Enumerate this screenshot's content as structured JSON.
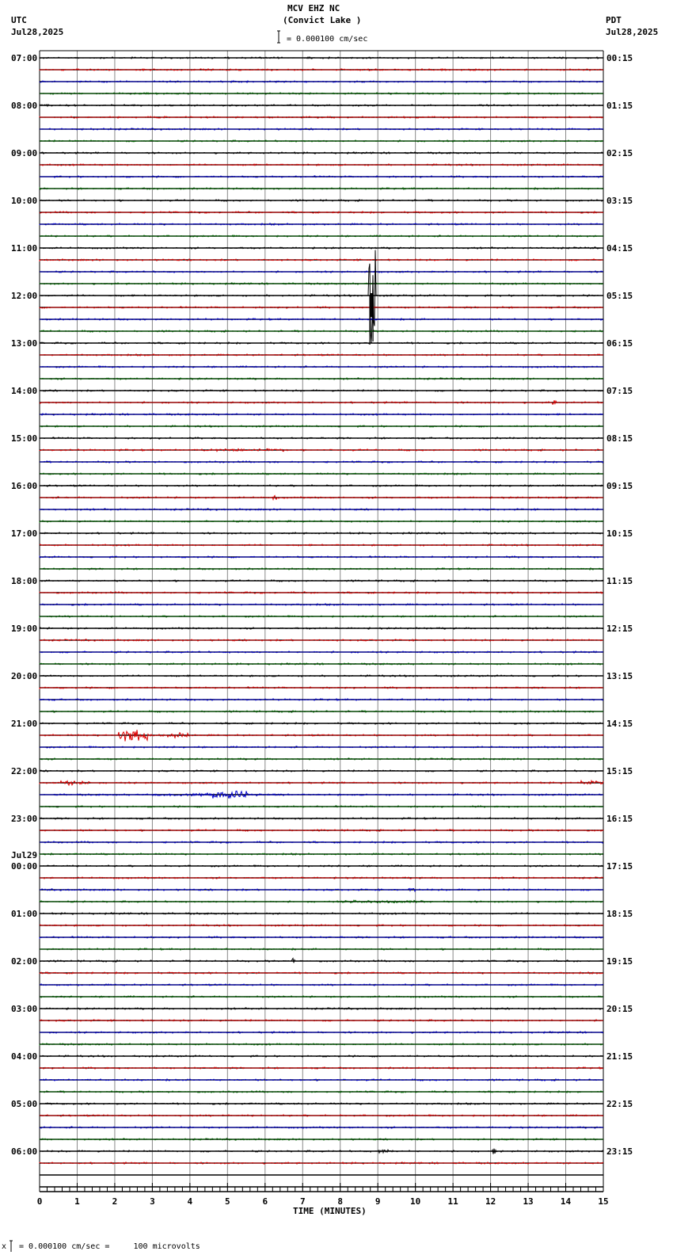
{
  "header": {
    "station": "MCV EHZ NC",
    "location": "(Convict Lake )",
    "scale_text": "= 0.000100 cm/sec",
    "left_tz": "UTC",
    "left_date": "Jul28,2025",
    "right_tz": "PDT",
    "right_date": "Jul28,2025"
  },
  "footer": {
    "scale_text": "= 0.000100 cm/sec =     100 microvolts",
    "marker": "x"
  },
  "chart_data": {
    "type": "line",
    "title": "MCV EHZ NC (Convict Lake )",
    "xlabel": "TIME (MINUTES)",
    "xlim": [
      0,
      15
    ],
    "x_ticks": [
      "0",
      "1",
      "2",
      "3",
      "4",
      "5",
      "6",
      "7",
      "8",
      "9",
      "10",
      "11",
      "12",
      "13",
      "14",
      "15"
    ],
    "rows_per_hour": 4,
    "row_minutes": 15,
    "row_count": 96,
    "trace_colors": [
      "#000000",
      "#dd0000",
      "#0000cc",
      "#006600"
    ],
    "left_labels": [
      {
        "row": 0,
        "text": "07:00"
      },
      {
        "row": 4,
        "text": "08:00"
      },
      {
        "row": 8,
        "text": "09:00"
      },
      {
        "row": 12,
        "text": "10:00"
      },
      {
        "row": 16,
        "text": "11:00"
      },
      {
        "row": 20,
        "text": "12:00"
      },
      {
        "row": 24,
        "text": "13:00"
      },
      {
        "row": 28,
        "text": "14:00"
      },
      {
        "row": 32,
        "text": "15:00"
      },
      {
        "row": 36,
        "text": "16:00"
      },
      {
        "row": 40,
        "text": "17:00"
      },
      {
        "row": 44,
        "text": "18:00"
      },
      {
        "row": 48,
        "text": "19:00"
      },
      {
        "row": 52,
        "text": "20:00"
      },
      {
        "row": 56,
        "text": "21:00"
      },
      {
        "row": 60,
        "text": "22:00"
      },
      {
        "row": 64,
        "text": "23:00"
      },
      {
        "row": 68,
        "text": "00:00",
        "date": "Jul29"
      },
      {
        "row": 72,
        "text": "01:00"
      },
      {
        "row": 76,
        "text": "02:00"
      },
      {
        "row": 80,
        "text": "03:00"
      },
      {
        "row": 84,
        "text": "04:00"
      },
      {
        "row": 88,
        "text": "05:00"
      },
      {
        "row": 92,
        "text": "06:00"
      }
    ],
    "right_labels": [
      {
        "row": 0,
        "text": "00:15"
      },
      {
        "row": 4,
        "text": "01:15"
      },
      {
        "row": 8,
        "text": "02:15"
      },
      {
        "row": 12,
        "text": "03:15"
      },
      {
        "row": 16,
        "text": "04:15"
      },
      {
        "row": 20,
        "text": "05:15"
      },
      {
        "row": 24,
        "text": "06:15"
      },
      {
        "row": 28,
        "text": "07:15"
      },
      {
        "row": 32,
        "text": "08:15"
      },
      {
        "row": 36,
        "text": "09:15"
      },
      {
        "row": 40,
        "text": "10:15"
      },
      {
        "row": 44,
        "text": "11:15"
      },
      {
        "row": 48,
        "text": "12:15"
      },
      {
        "row": 52,
        "text": "13:15"
      },
      {
        "row": 56,
        "text": "14:15"
      },
      {
        "row": 60,
        "text": "15:15"
      },
      {
        "row": 64,
        "text": "16:15"
      },
      {
        "row": 68,
        "text": "17:15"
      },
      {
        "row": 72,
        "text": "18:15"
      },
      {
        "row": 76,
        "text": "19:15"
      },
      {
        "row": 80,
        "text": "20:15"
      },
      {
        "row": 84,
        "text": "21:15"
      },
      {
        "row": 88,
        "text": "22:15"
      },
      {
        "row": 92,
        "text": "23:15"
      }
    ],
    "data_rows": 94,
    "events": [
      {
        "row": 20,
        "start": 8.75,
        "end": 8.95,
        "amp": 60,
        "kind": "spike"
      },
      {
        "row": 29,
        "start": 13.65,
        "end": 13.75,
        "amp": 4,
        "kind": "spike"
      },
      {
        "row": 33,
        "start": 4.3,
        "end": 6.5,
        "amp": 2
      },
      {
        "row": 37,
        "start": 6.2,
        "end": 6.3,
        "amp": 4,
        "kind": "spike"
      },
      {
        "row": 57,
        "start": 2.1,
        "end": 2.9,
        "amp": 8
      },
      {
        "row": 57,
        "start": 3.4,
        "end": 4.0,
        "amp": 4
      },
      {
        "row": 61,
        "start": 14.4,
        "end": 15.0,
        "amp": 3
      },
      {
        "row": 61,
        "start": 0.55,
        "end": 1.35,
        "amp": 4
      },
      {
        "row": 62,
        "start": 3.0,
        "end": 4.6,
        "amp": 2
      },
      {
        "row": 62,
        "start": 4.6,
        "end": 5.5,
        "amp": 6
      },
      {
        "row": 62,
        "start": 5.5,
        "end": 6.5,
        "amp": 2
      },
      {
        "row": 70,
        "start": 9.8,
        "end": 10.0,
        "amp": 3
      },
      {
        "row": 71,
        "start": 8.0,
        "end": 10.4,
        "amp": 2
      },
      {
        "row": 76,
        "start": 6.7,
        "end": 6.8,
        "amp": 5,
        "kind": "spike"
      },
      {
        "row": 92,
        "start": 9.0,
        "end": 9.4,
        "amp": 3
      },
      {
        "row": 92,
        "start": 12.05,
        "end": 12.15,
        "amp": 5,
        "kind": "spike"
      }
    ]
  }
}
